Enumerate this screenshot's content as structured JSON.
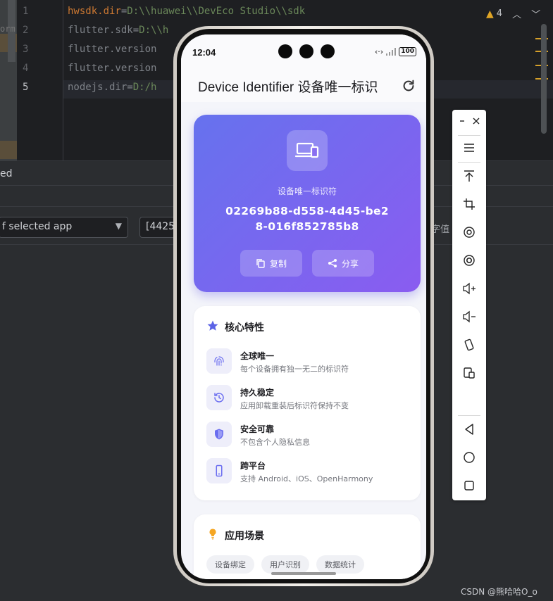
{
  "ide": {
    "line_numbers": [
      "1",
      "2",
      "3",
      "4",
      "5"
    ],
    "lines": [
      {
        "key": "hwsdk.dir",
        "eq": "=",
        "val": "D:\\\\huawei\\\\DevEco Studio\\\\sdk"
      },
      {
        "key": "flutter.sdk",
        "eq": "=",
        "val": "D:\\\\h"
      },
      {
        "key": "flutter.version",
        "eq": "",
        "val": ""
      },
      {
        "key": "flutter.version",
        "eq": "",
        "val": ""
      },
      {
        "key": "nodejs.dir",
        "eq": "=",
        "val": "D:/h"
      }
    ],
    "left_fragment": "orm",
    "warnings_count": "4",
    "panel_label": "ed",
    "app_filter": "f selected app",
    "pid_field": "[4425",
    "right_fragment": "字值"
  },
  "phone": {
    "status": {
      "time": "12:04",
      "battery": "100"
    },
    "app_title": "Device Identifier 设备唯一标识",
    "hero": {
      "label": "设备唯一标识符",
      "id": "02269b88-d558-4d45-be28-016f852785b8",
      "copy_label": "复制",
      "share_label": "分享"
    },
    "features_card": {
      "title": "核心特性",
      "items": [
        {
          "title": "全球唯一",
          "desc": "每个设备拥有独一无二的标识符",
          "icon": "fingerprint-icon"
        },
        {
          "title": "持久稳定",
          "desc": "应用卸载重装后标识符保持不变",
          "icon": "history-icon"
        },
        {
          "title": "安全可靠",
          "desc": "不包含个人隐私信息",
          "icon": "shield-icon"
        },
        {
          "title": "跨平台",
          "desc": "支持 Android、iOS、OpenHarmony",
          "icon": "phone-icon"
        }
      ]
    },
    "scenarios_card": {
      "title": "应用场景",
      "chips": [
        "设备绑定",
        "用户识别",
        "数据统计"
      ]
    }
  },
  "colors": {
    "accent": "#6b6ef0",
    "hero_start": "#6672ee",
    "hero_end": "#8a5cf0",
    "star": "#5b63e6",
    "bulb": "#f5a623"
  },
  "toolbar_icons": [
    "minimize-icon",
    "close-icon",
    "menu-icon",
    "pin-top-icon",
    "crop-icon",
    "rotate-icon",
    "screenshot-icon",
    "volume-up-icon",
    "volume-down-icon",
    "rotate-device-icon",
    "multi-device-icon",
    "back-icon",
    "home-icon",
    "recents-icon"
  ],
  "watermark": "CSDN @熊哈哈O_o"
}
